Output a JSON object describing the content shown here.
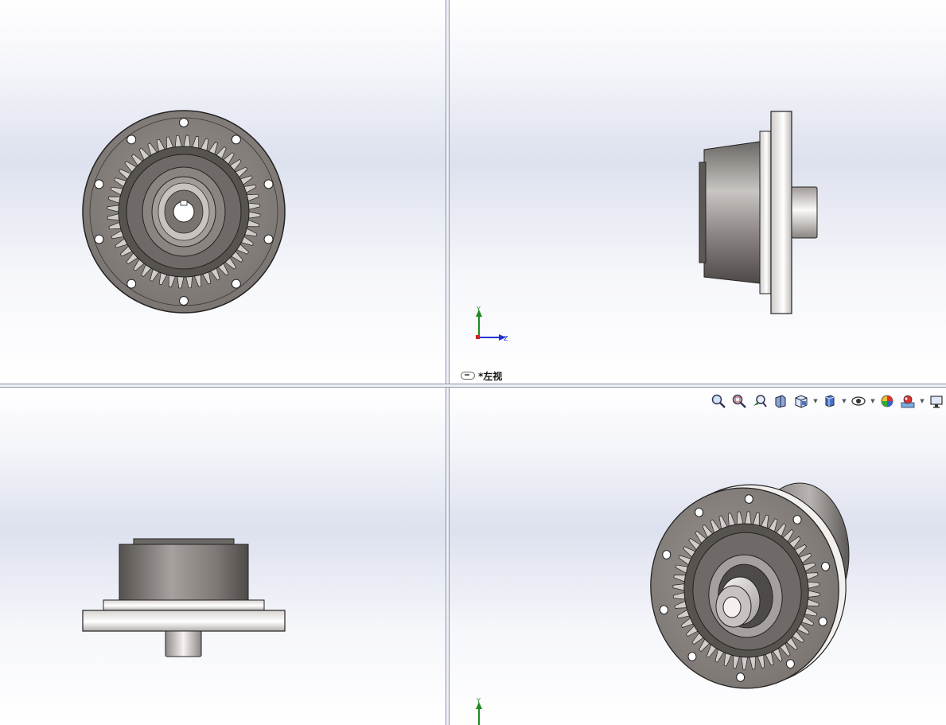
{
  "viewports": {
    "top_right": {
      "view_label": "*左视",
      "triad": {
        "y_label": "Y",
        "z_label": "Z"
      }
    },
    "bottom_right": {
      "triad": {
        "y_label": "Y"
      }
    }
  },
  "heads_up_toolbar": {
    "buttons": [
      {
        "icon": "zoom-to-fit-icon",
        "has_dropdown": false
      },
      {
        "icon": "zoom-to-area-icon",
        "has_dropdown": false
      },
      {
        "icon": "previous-view-icon",
        "has_dropdown": false
      },
      {
        "icon": "section-view-icon",
        "has_dropdown": false
      },
      {
        "icon": "view-orientation-icon",
        "has_dropdown": true
      },
      {
        "icon": "display-style-icon",
        "has_dropdown": true
      },
      {
        "icon": "hide-show-items-icon",
        "has_dropdown": true
      },
      {
        "icon": "edit-appearance-icon",
        "has_dropdown": false
      },
      {
        "icon": "apply-scene-icon",
        "has_dropdown": true
      },
      {
        "icon": "view-settings-icon",
        "has_dropdown": false
      }
    ]
  },
  "colors": {
    "axis_y": "#1f8a1f",
    "axis_z": "#2233cc",
    "axis_x": "#cc2222",
    "part_dark": "#5e5a57",
    "part_mid": "#8d8784",
    "part_light": "#d9d4d1"
  }
}
